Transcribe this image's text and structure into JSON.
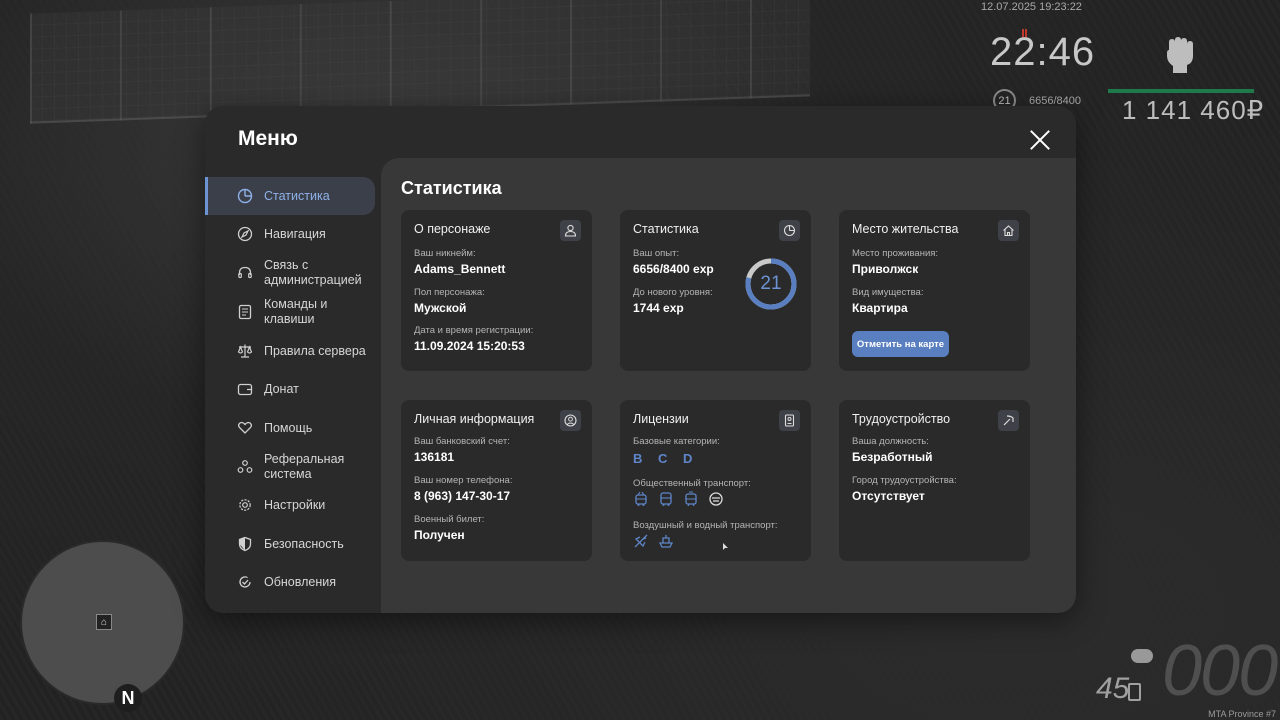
{
  "hud": {
    "datetime": "12.07.2025 19:23:22",
    "time": "22:46",
    "level": "21",
    "exp": "6656/8400",
    "money": "1 141 460₽",
    "fuel": "45",
    "speed": "000",
    "watermark": "MTA Province #7",
    "north": "N"
  },
  "menu": {
    "title": "Меню",
    "nav": [
      {
        "label": "Статистика",
        "icon": "pie-chart-icon",
        "active": true
      },
      {
        "label": "Навигация",
        "icon": "compass-icon"
      },
      {
        "label": "Связь с администрацией",
        "icon": "headset-icon"
      },
      {
        "label": "Команды и клавиши",
        "icon": "document-icon"
      },
      {
        "label": "Правила сервера",
        "icon": "scales-icon"
      },
      {
        "label": "Донат",
        "icon": "wallet-icon"
      },
      {
        "label": "Помощь",
        "icon": "heart-hand-icon"
      },
      {
        "label": "Реферальная система",
        "icon": "people-icon"
      },
      {
        "label": "Настройки",
        "icon": "gear-icon"
      },
      {
        "label": "Безопасность",
        "icon": "shield-icon"
      },
      {
        "label": "Обновления",
        "icon": "refresh-icon"
      }
    ]
  },
  "content": {
    "title": "Статистика",
    "character": {
      "title": "О персонаже",
      "nickname_label": "Ваш никнейм:",
      "nickname": "Adams_Bennett",
      "gender_label": "Пол персонажа:",
      "gender": "Мужской",
      "reg_label": "Дата и время регистрации:",
      "reg": "11.09.2024 15:20:53"
    },
    "stats": {
      "title": "Статистика",
      "exp_label": "Ваш опыт:",
      "exp": "6656/8400 exp",
      "next_label": "До нового уровня:",
      "next": "1744 exp",
      "level": "21",
      "progress": 0.792
    },
    "residence": {
      "title": "Место жительства",
      "place_label": "Место проживания:",
      "place": "Приволжск",
      "property_label": "Вид имущества:",
      "property": "Квартира",
      "map_button": "Отметить на карте"
    },
    "personal": {
      "title": "Личная информация",
      "bank_label": "Ваш банковский счет:",
      "bank": "136181",
      "phone_label": "Ваш номер телефона:",
      "phone": "8 (963) 147-30-17",
      "military_label": "Военный билет:",
      "military": "Получен"
    },
    "licenses": {
      "title": "Лицензии",
      "base_label": "Базовые категории:",
      "base": "B C D",
      "public_label": "Общественный транспорт:",
      "public_icons": [
        "trolleybus-icon",
        "bus-icon",
        "tram-icon",
        "taxi-icon"
      ],
      "air_label": "Воздушный и водный транспорт:",
      "air_icons": [
        "plane-icon",
        "boat-icon"
      ]
    },
    "job": {
      "title": "Трудоустройство",
      "position_label": "Ваша должность:",
      "position": "Безработный",
      "city_label": "Город трудоустройства:",
      "city": "Отсутствует"
    }
  },
  "colors": {
    "accent": "#5a7fc0",
    "accent_light": "#8fb1e8",
    "panel": "#2a2a2b",
    "content_bg": "#383839",
    "health": "#1e7a4a"
  }
}
